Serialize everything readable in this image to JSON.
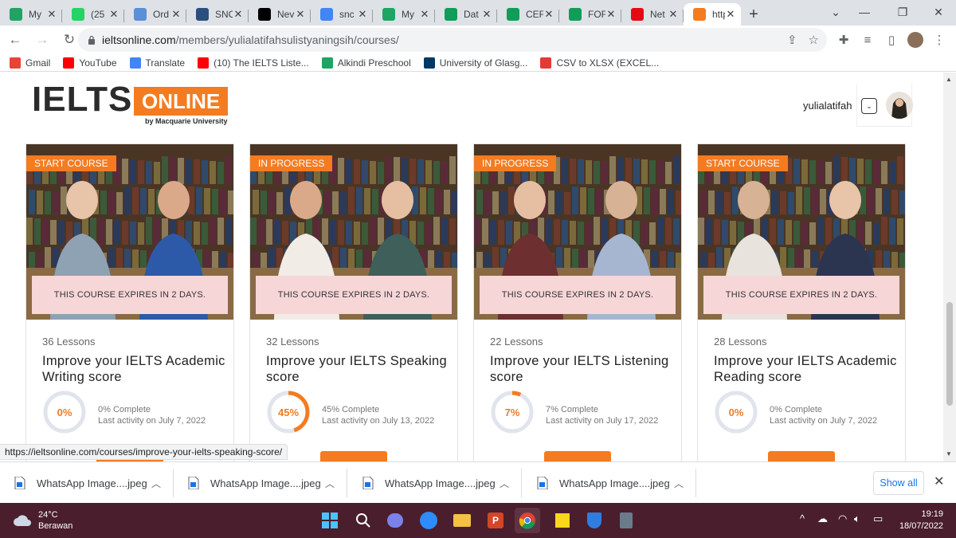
{
  "browser": {
    "tabs": [
      {
        "title": "My",
        "icon": "google-drive-icon",
        "color": "#1fa463"
      },
      {
        "title": "(25",
        "icon": "whatsapp-icon",
        "color": "#25d366"
      },
      {
        "title": "Ord",
        "icon": "hand-icon",
        "color": "#5b8fd6"
      },
      {
        "title": "SNC",
        "icon": "globe-icon",
        "color": "#2a4f7e"
      },
      {
        "title": "Nev",
        "icon": "medium-icon",
        "color": "#000000"
      },
      {
        "title": "snc",
        "icon": "google-icon",
        "color": "#4285f4"
      },
      {
        "title": "My",
        "icon": "google-drive-icon",
        "color": "#1fa463"
      },
      {
        "title": "Dat",
        "icon": "sheets-icon",
        "color": "#0f9d58"
      },
      {
        "title": "CEF",
        "icon": "sheets-icon",
        "color": "#0f9d58"
      },
      {
        "title": "FOF",
        "icon": "sheets-icon",
        "color": "#0f9d58"
      },
      {
        "title": "Net",
        "icon": "netflix-icon",
        "color": "#e50914"
      },
      {
        "title": "http",
        "icon": "ielts-favicon",
        "color": "#f47b20"
      }
    ],
    "url_host": "ieltsonline.com",
    "url_path": "/members/yulialatifahsulistyaningsih/courses/",
    "bookmarks": [
      {
        "label": "Gmail",
        "icon": "gmail-icon",
        "color": "#ea4335"
      },
      {
        "label": "YouTube",
        "icon": "youtube-icon",
        "color": "#ff0000"
      },
      {
        "label": "Translate",
        "icon": "translate-icon",
        "color": "#4285f4"
      },
      {
        "label": "(10) The IELTS Liste...",
        "icon": "youtube-icon",
        "color": "#ff0000"
      },
      {
        "label": "Alkindi Preschool",
        "icon": "google-drive-icon",
        "color": "#1fa463"
      },
      {
        "label": "University of Glasg...",
        "icon": "university-crest-icon",
        "color": "#003865"
      },
      {
        "label": "CSV to XLSX (EXCEL...",
        "icon": "convert-icon",
        "color": "#e53935"
      }
    ]
  },
  "site": {
    "logo_main": "IELTS",
    "logo_badge": "ONLINE",
    "logo_sub": "by Macquarie University",
    "username": "yulialatifah",
    "accent": "#f47b20"
  },
  "courses": [
    {
      "status": "START COURSE",
      "expires": "THIS COURSE EXPIRES IN 2 DAYS.",
      "lessons": "36 Lessons",
      "title": "Improve your IELTS Academic Writing score",
      "progress": 0,
      "progress_label": "0%",
      "complete": "0% Complete",
      "activity": "Last activity on July 7, 2022"
    },
    {
      "status": "IN PROGRESS",
      "expires": "THIS COURSE EXPIRES IN 2 DAYS.",
      "lessons": "32 Lessons",
      "title": "Improve your IELTS Speaking score",
      "progress": 45,
      "progress_label": "45%",
      "complete": "45% Complete",
      "activity": "Last activity on July 13, 2022"
    },
    {
      "status": "IN PROGRESS",
      "expires": "THIS COURSE EXPIRES IN 2 DAYS.",
      "lessons": "22 Lessons",
      "title": "Improve your IELTS Listening score",
      "progress": 7,
      "progress_label": "7%",
      "complete": "7% Complete",
      "activity": "Last activity on July 17, 2022"
    },
    {
      "status": "START COURSE",
      "expires": "THIS COURSE EXPIRES IN 2 DAYS.",
      "lessons": "28 Lessons",
      "title": "Improve your IELTS Academic Reading score",
      "progress": 0,
      "progress_label": "0%",
      "complete": "0% Complete",
      "activity": "Last activity on July 7, 2022"
    }
  ],
  "status_link": "https://ieltsonline.com/courses/improve-your-ielts-speaking-score/",
  "downloads": {
    "items": [
      "WhatsApp Image....jpeg",
      "WhatsApp Image....jpeg",
      "WhatsApp Image....jpeg",
      "WhatsApp Image....jpeg"
    ],
    "show_all": "Show all"
  },
  "taskbar": {
    "temperature": "24°C",
    "weather": "Berawan",
    "time": "19:19",
    "date": "18/07/2022"
  }
}
